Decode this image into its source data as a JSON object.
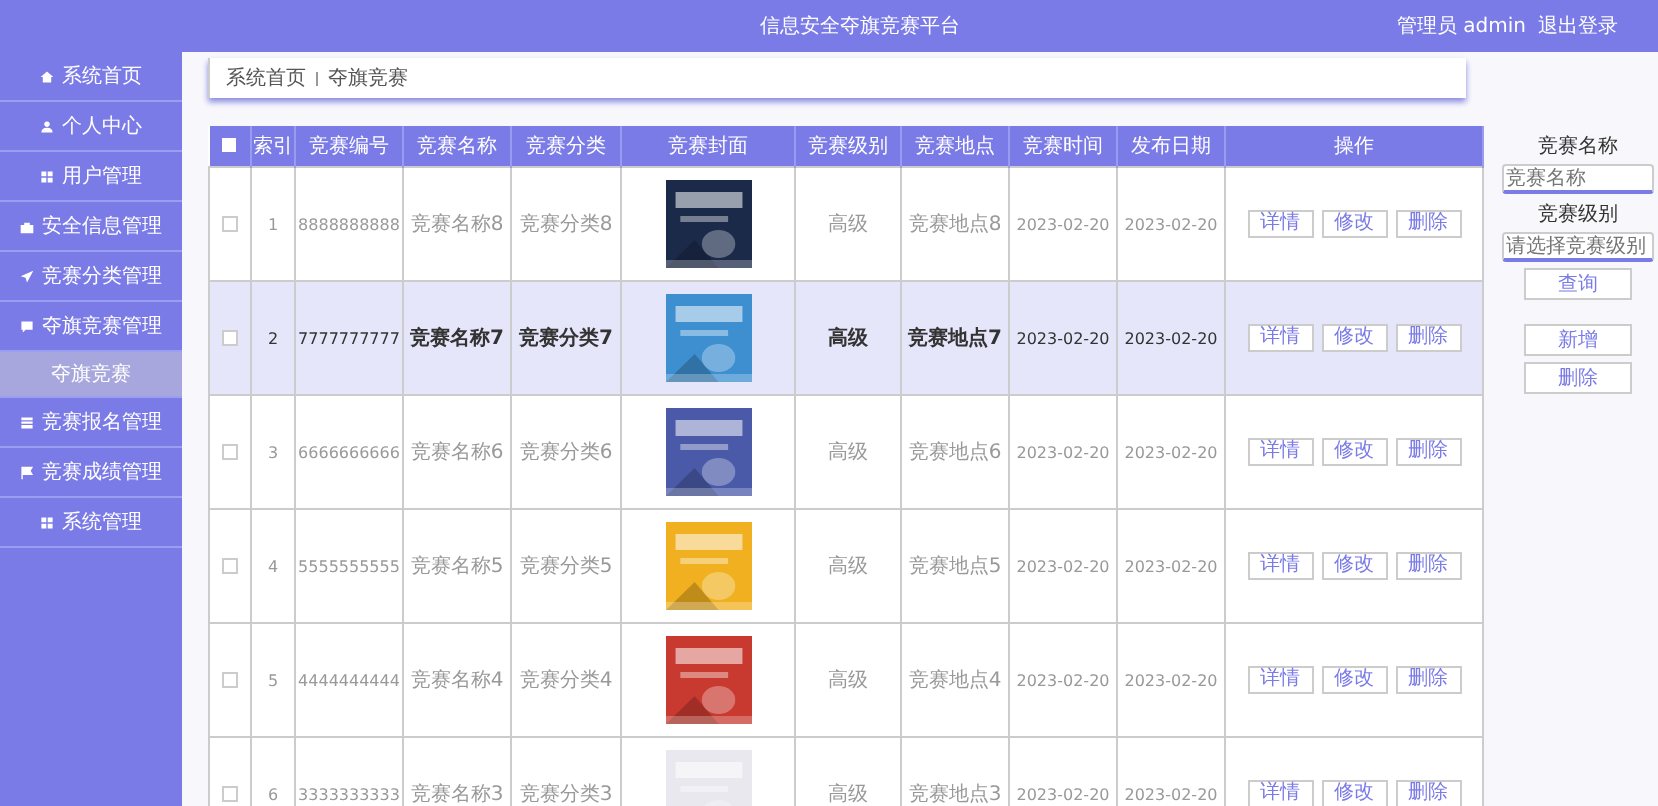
{
  "header": {
    "title": "信息安全夺旗竞赛平台",
    "user": "管理员 admin",
    "logout": "退出登录"
  },
  "sidebar": {
    "items": [
      {
        "label": "系统首页"
      },
      {
        "label": "个人中心"
      },
      {
        "label": "用户管理"
      },
      {
        "label": "安全信息管理"
      },
      {
        "label": "竞赛分类管理"
      },
      {
        "label": "夺旗竞赛管理",
        "children": [
          {
            "label": "夺旗竞赛",
            "selected": true
          }
        ]
      },
      {
        "label": "竞赛报名管理"
      },
      {
        "label": "竞赛成绩管理"
      },
      {
        "label": "系统管理"
      }
    ]
  },
  "breadcrumb": [
    "系统首页",
    "夺旗竞赛"
  ],
  "table": {
    "header_checked": false,
    "columns": [
      "索引",
      "竞赛编号",
      "竞赛名称",
      "竞赛分类",
      "竞赛封面",
      "竞赛级别",
      "竞赛地点",
      "竞赛时间",
      "发布日期",
      "操作"
    ],
    "rows": [
      {
        "checked": false,
        "selected": false,
        "index": "1",
        "code": "8888888888",
        "name": "竞赛名称8",
        "category": "竞赛分类8",
        "level": "高级",
        "place": "竞赛地点8",
        "time": "2023-02-20",
        "date": "2023-02-20",
        "actions": [
          "详情",
          "修改",
          "删除"
        ]
      },
      {
        "checked": false,
        "selected": true,
        "index": "2",
        "code": "7777777777",
        "name": "竞赛名称7",
        "category": "竞赛分类7",
        "level": "高级",
        "place": "竞赛地点7",
        "time": "2023-02-20",
        "date": "2023-02-20",
        "actions": [
          "详情",
          "修改",
          "删除"
        ]
      },
      {
        "checked": false,
        "selected": false,
        "index": "3",
        "code": "6666666666",
        "name": "竞赛名称6",
        "category": "竞赛分类6",
        "level": "高级",
        "place": "竞赛地点6",
        "time": "2023-02-20",
        "date": "2023-02-20",
        "actions": [
          "详情",
          "修改",
          "删除"
        ]
      },
      {
        "checked": false,
        "selected": false,
        "index": "4",
        "code": "5555555555",
        "name": "竞赛名称5",
        "category": "竞赛分类5",
        "level": "高级",
        "place": "竞赛地点5",
        "time": "2023-02-20",
        "date": "2023-02-20",
        "actions": [
          "详情",
          "修改",
          "删除"
        ]
      },
      {
        "checked": false,
        "selected": false,
        "index": "5",
        "code": "4444444444",
        "name": "竞赛名称4",
        "category": "竞赛分类4",
        "level": "高级",
        "place": "竞赛地点4",
        "time": "2023-02-20",
        "date": "2023-02-20",
        "actions": [
          "详情",
          "修改",
          "删除"
        ]
      },
      {
        "checked": false,
        "selected": false,
        "index": "6",
        "code": "3333333333",
        "name": "竞赛名称3",
        "category": "竞赛分类3",
        "level": "高级",
        "place": "竞赛地点3",
        "time": "2023-02-20",
        "date": "2023-02-20",
        "actions": [
          "详情",
          "修改",
          "删除"
        ]
      }
    ]
  },
  "search": {
    "name_label": "竞赛名称",
    "name_placeholder": "竞赛名称",
    "level_label": "竞赛级别",
    "level_placeholder": "请选择竞赛级别",
    "query": "查询",
    "add": "新增",
    "delete": "删除"
  }
}
